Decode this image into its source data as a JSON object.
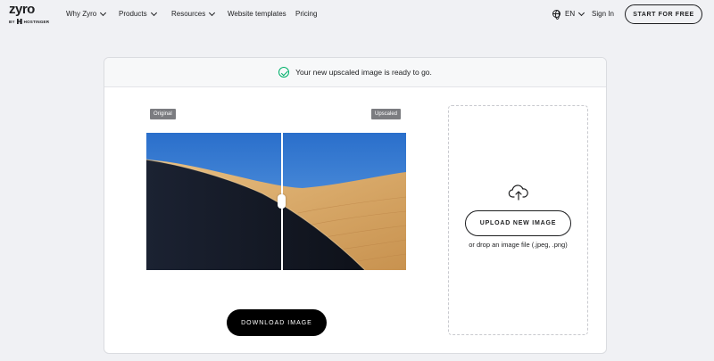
{
  "brand": {
    "name": "zyro",
    "byline": "BY",
    "parent": "HOSTINGER"
  },
  "nav": {
    "items": [
      {
        "label": "Why Zyro",
        "dropdown": true
      },
      {
        "label": "Products",
        "dropdown": true
      },
      {
        "label": "Resources",
        "dropdown": true
      },
      {
        "label": "Website templates",
        "dropdown": false
      },
      {
        "label": "Pricing",
        "dropdown": false
      }
    ],
    "language": "EN",
    "sign_in": "Sign In",
    "cta": "START FOR FREE"
  },
  "result": {
    "message": "Your new upscaled image is ready to go.",
    "original_label": "Original",
    "upscaled_label": "Upscaled",
    "comparison_split_percent": 52,
    "download_label": "DOWNLOAD IMAGE"
  },
  "upload": {
    "button_label": "UPLOAD NEW IMAGE",
    "hint": "or drop an image file (.jpeg, .png)"
  },
  "colors": {
    "accent_success": "#00b16a",
    "background": "#f0f1f4",
    "sky": "#2f78d2",
    "sand": "#d9a966",
    "shadow": "#141824"
  }
}
